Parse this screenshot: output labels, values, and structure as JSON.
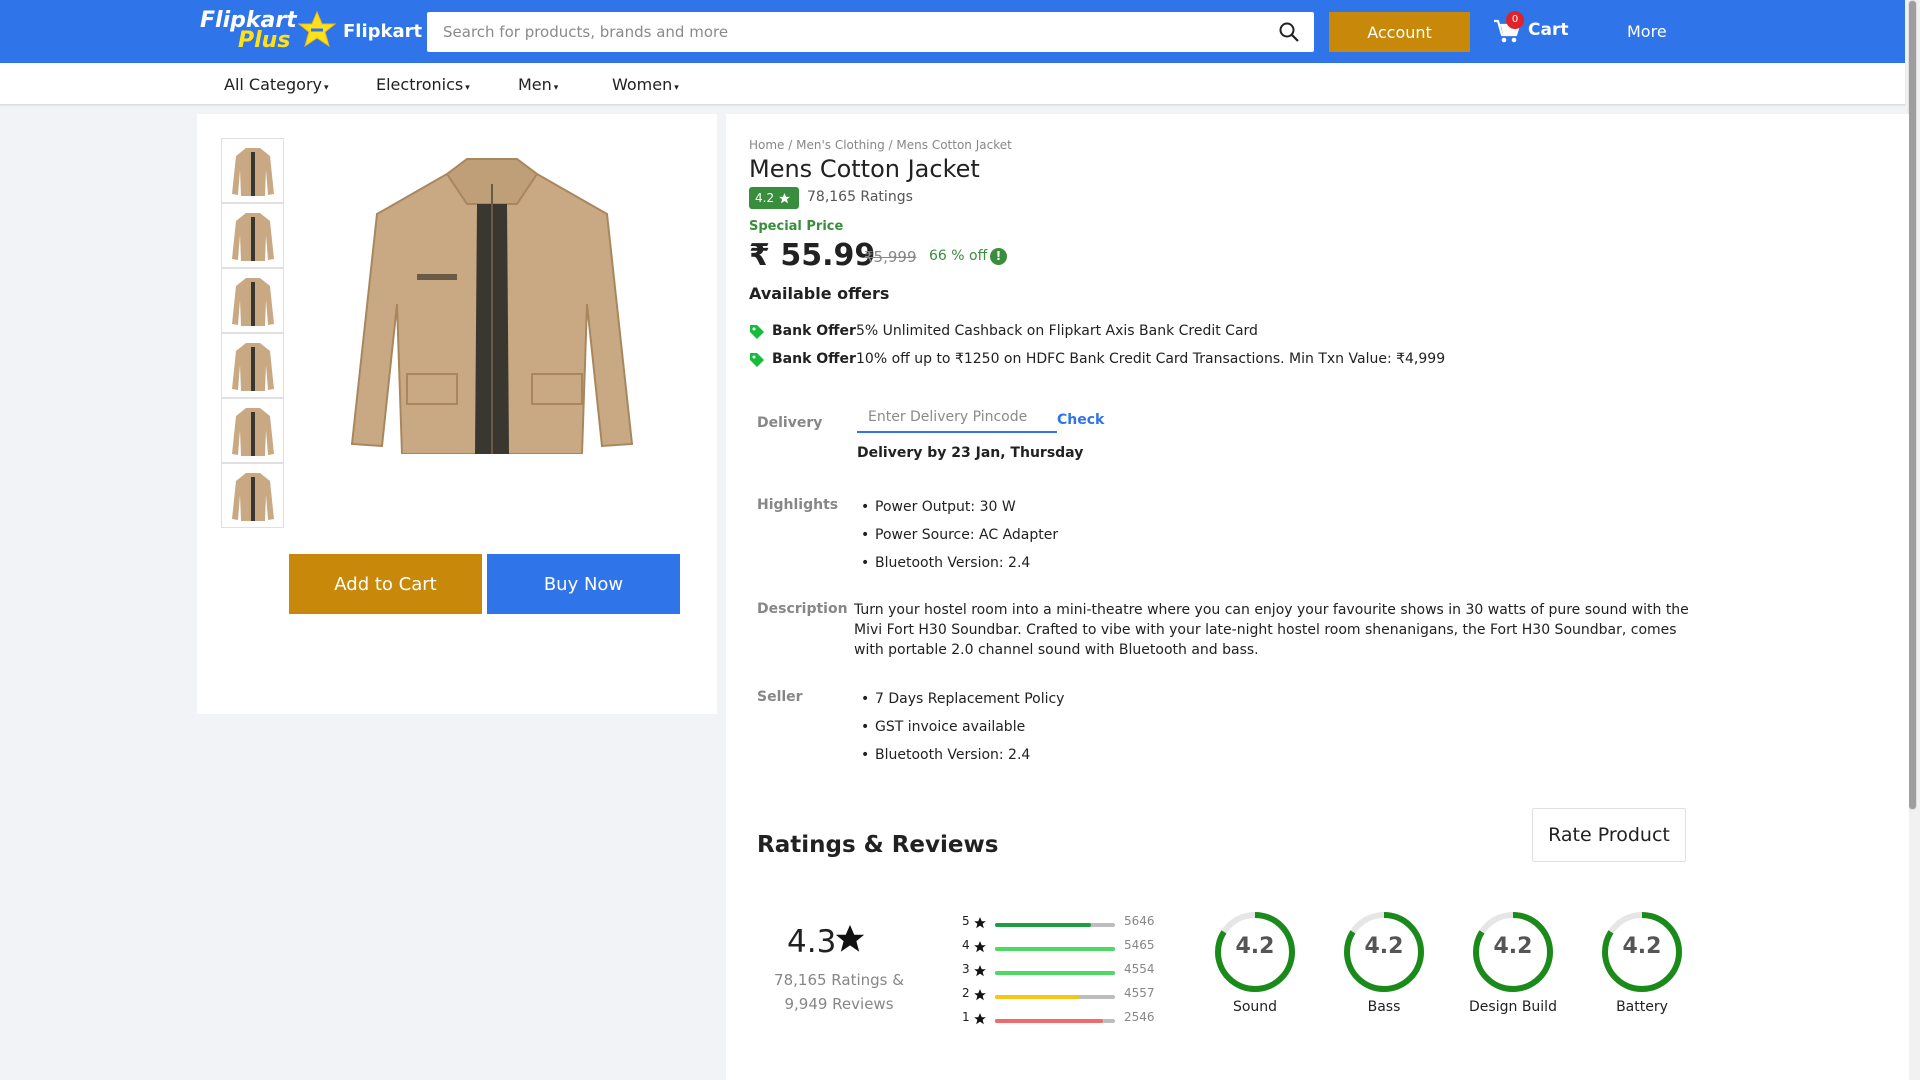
{
  "header": {
    "logo_text": "Flipkart",
    "logo_plus": "Plus",
    "brand": "Flipkart",
    "search_placeholder": "Search for products, brands and more",
    "account_label": "Account",
    "cart_count": "0",
    "cart_label": "Cart",
    "more_label": "More"
  },
  "categories": [
    "All Category",
    "Electronics",
    "Men",
    "Women"
  ],
  "gallery": {
    "thumb_count": 6,
    "add_to_cart": "Add to Cart",
    "buy_now": "Buy Now"
  },
  "product": {
    "breadcrumb": "Home / Men's Clothing / Mens Cotton Jacket",
    "title": "Mens Cotton Jacket",
    "rating": "4.2",
    "ratings_count": "78,165 Ratings",
    "special_price_label": "Special Price",
    "price": "₹ 55.99",
    "mrp": "₹5,999",
    "discount": "66 % off",
    "info_icon": "!"
  },
  "offers": {
    "heading": "Available offers",
    "items": [
      {
        "tag": "Bank Offer",
        "text": "5% Unlimited Cashback on Flipkart Axis Bank Credit Card"
      },
      {
        "tag": "Bank Offer",
        "text": "10% off up to ₹1250 on HDFC Bank Credit Card Transactions. Min Txn Value: ₹4,999"
      }
    ]
  },
  "delivery": {
    "label": "Delivery",
    "pincode_placeholder": "Enter Delivery Pincode",
    "check_label": "Check",
    "date_text": "Delivery by 23 Jan, Thursday"
  },
  "highlights": {
    "label": "Highlights",
    "items": [
      "Power Output: 30 W",
      "Power Source: AC Adapter",
      "Bluetooth Version: 2.4"
    ]
  },
  "description": {
    "label": "Description",
    "text": "Turn your hostel room into a mini-theatre where you can enjoy your favourite shows in 30 watts of pure sound with the Mivi Fort H30 Soundbar. Crafted to vibe with your late-night hostel room shenanigans, the Fort H30 Soundbar, comes with portable 2.0 channel sound with Bluetooth and bass."
  },
  "seller": {
    "label": "Seller",
    "items": [
      " 7 Days Replacement Policy",
      "GST invoice available",
      "Bluetooth Version: 2.4"
    ]
  },
  "reviews": {
    "title": "Ratings & Reviews",
    "rate_button": "Rate Product",
    "overall": "4.3",
    "ratings_line": "78,165 Ratings &",
    "reviews_line": "9,949 Reviews",
    "distribution": [
      {
        "star": "5",
        "count": "5646",
        "fill": 0.8,
        "color": "#1e9e3e"
      },
      {
        "star": "4",
        "count": "5465",
        "fill": 1.0,
        "color": "#4cd964"
      },
      {
        "star": "3",
        "count": "4554",
        "fill": 1.0,
        "color": "#4cd964"
      },
      {
        "star": "2",
        "count": "4557",
        "fill": 0.7,
        "color": "#f5c518"
      },
      {
        "star": "1",
        "count": "2546",
        "fill": 0.9,
        "color": "#ef6b6b"
      }
    ],
    "features": [
      {
        "label": "Sound",
        "value": "4.2",
        "fraction": 0.84
      },
      {
        "label": "Bass",
        "value": "4.2",
        "fraction": 0.84
      },
      {
        "label": "Design Build",
        "value": "4.2",
        "fraction": 0.84
      },
      {
        "label": "Battery",
        "value": "4.2",
        "fraction": 0.84
      }
    ]
  },
  "colors": {
    "header_blue": "#2f74e8",
    "accent_gold": "#c8890a",
    "green": "#388e3c"
  },
  "icons": [
    "search-icon",
    "cart-icon",
    "star-icon",
    "tag-icon",
    "info-icon"
  ]
}
